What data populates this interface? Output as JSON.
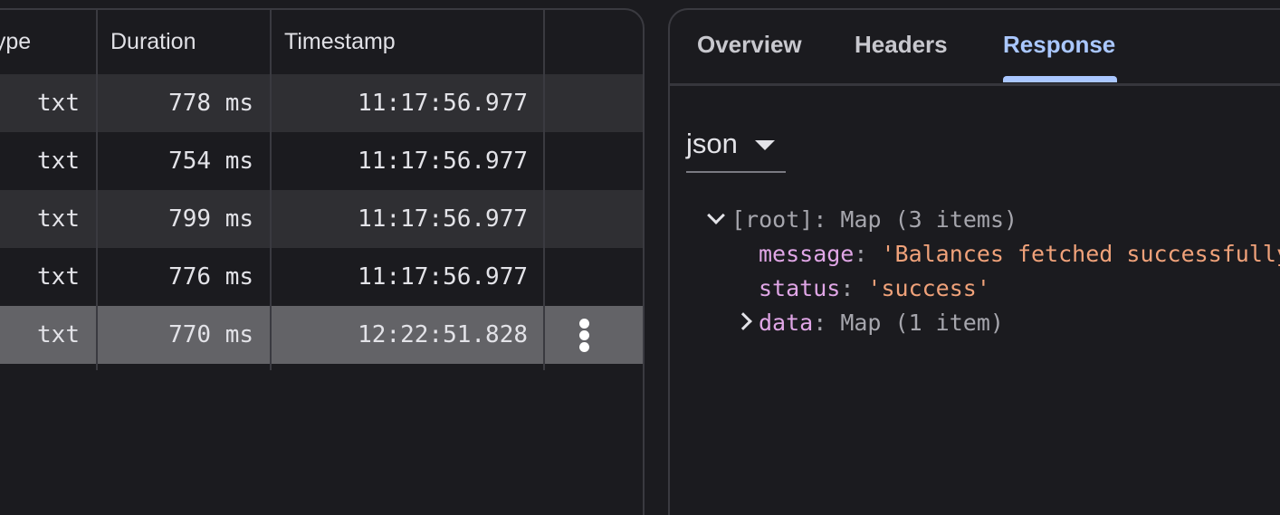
{
  "table": {
    "headers": {
      "type": "Type",
      "duration": "Duration",
      "timestamp": "Timestamp"
    },
    "rows": [
      {
        "type": "txt",
        "duration": "778 ms",
        "timestamp": "11:17:56.977"
      },
      {
        "type": "txt",
        "duration": "754 ms",
        "timestamp": "11:17:56.977"
      },
      {
        "type": "txt",
        "duration": "799 ms",
        "timestamp": "11:17:56.977"
      },
      {
        "type": "txt",
        "duration": "776 ms",
        "timestamp": "11:17:56.977"
      },
      {
        "type": "txt",
        "duration": "770 ms",
        "timestamp": "12:22:51.828"
      }
    ]
  },
  "detail": {
    "tabs": [
      "Overview",
      "Headers",
      "Response"
    ],
    "active_tab": "Response",
    "format": "json",
    "tree": {
      "root_key": "[root]",
      "root_value": "Map (3 items)",
      "message_key": "message",
      "message_value": "'Balances fetched successfully'",
      "status_key": "status",
      "status_value": "'success'",
      "data_key": "data",
      "data_value": "Map (1 item)"
    }
  },
  "colors": {
    "accent": "#aac7ff",
    "key": "#e0a6e6",
    "string": "#f0a27a",
    "selected_row": "#636367"
  }
}
